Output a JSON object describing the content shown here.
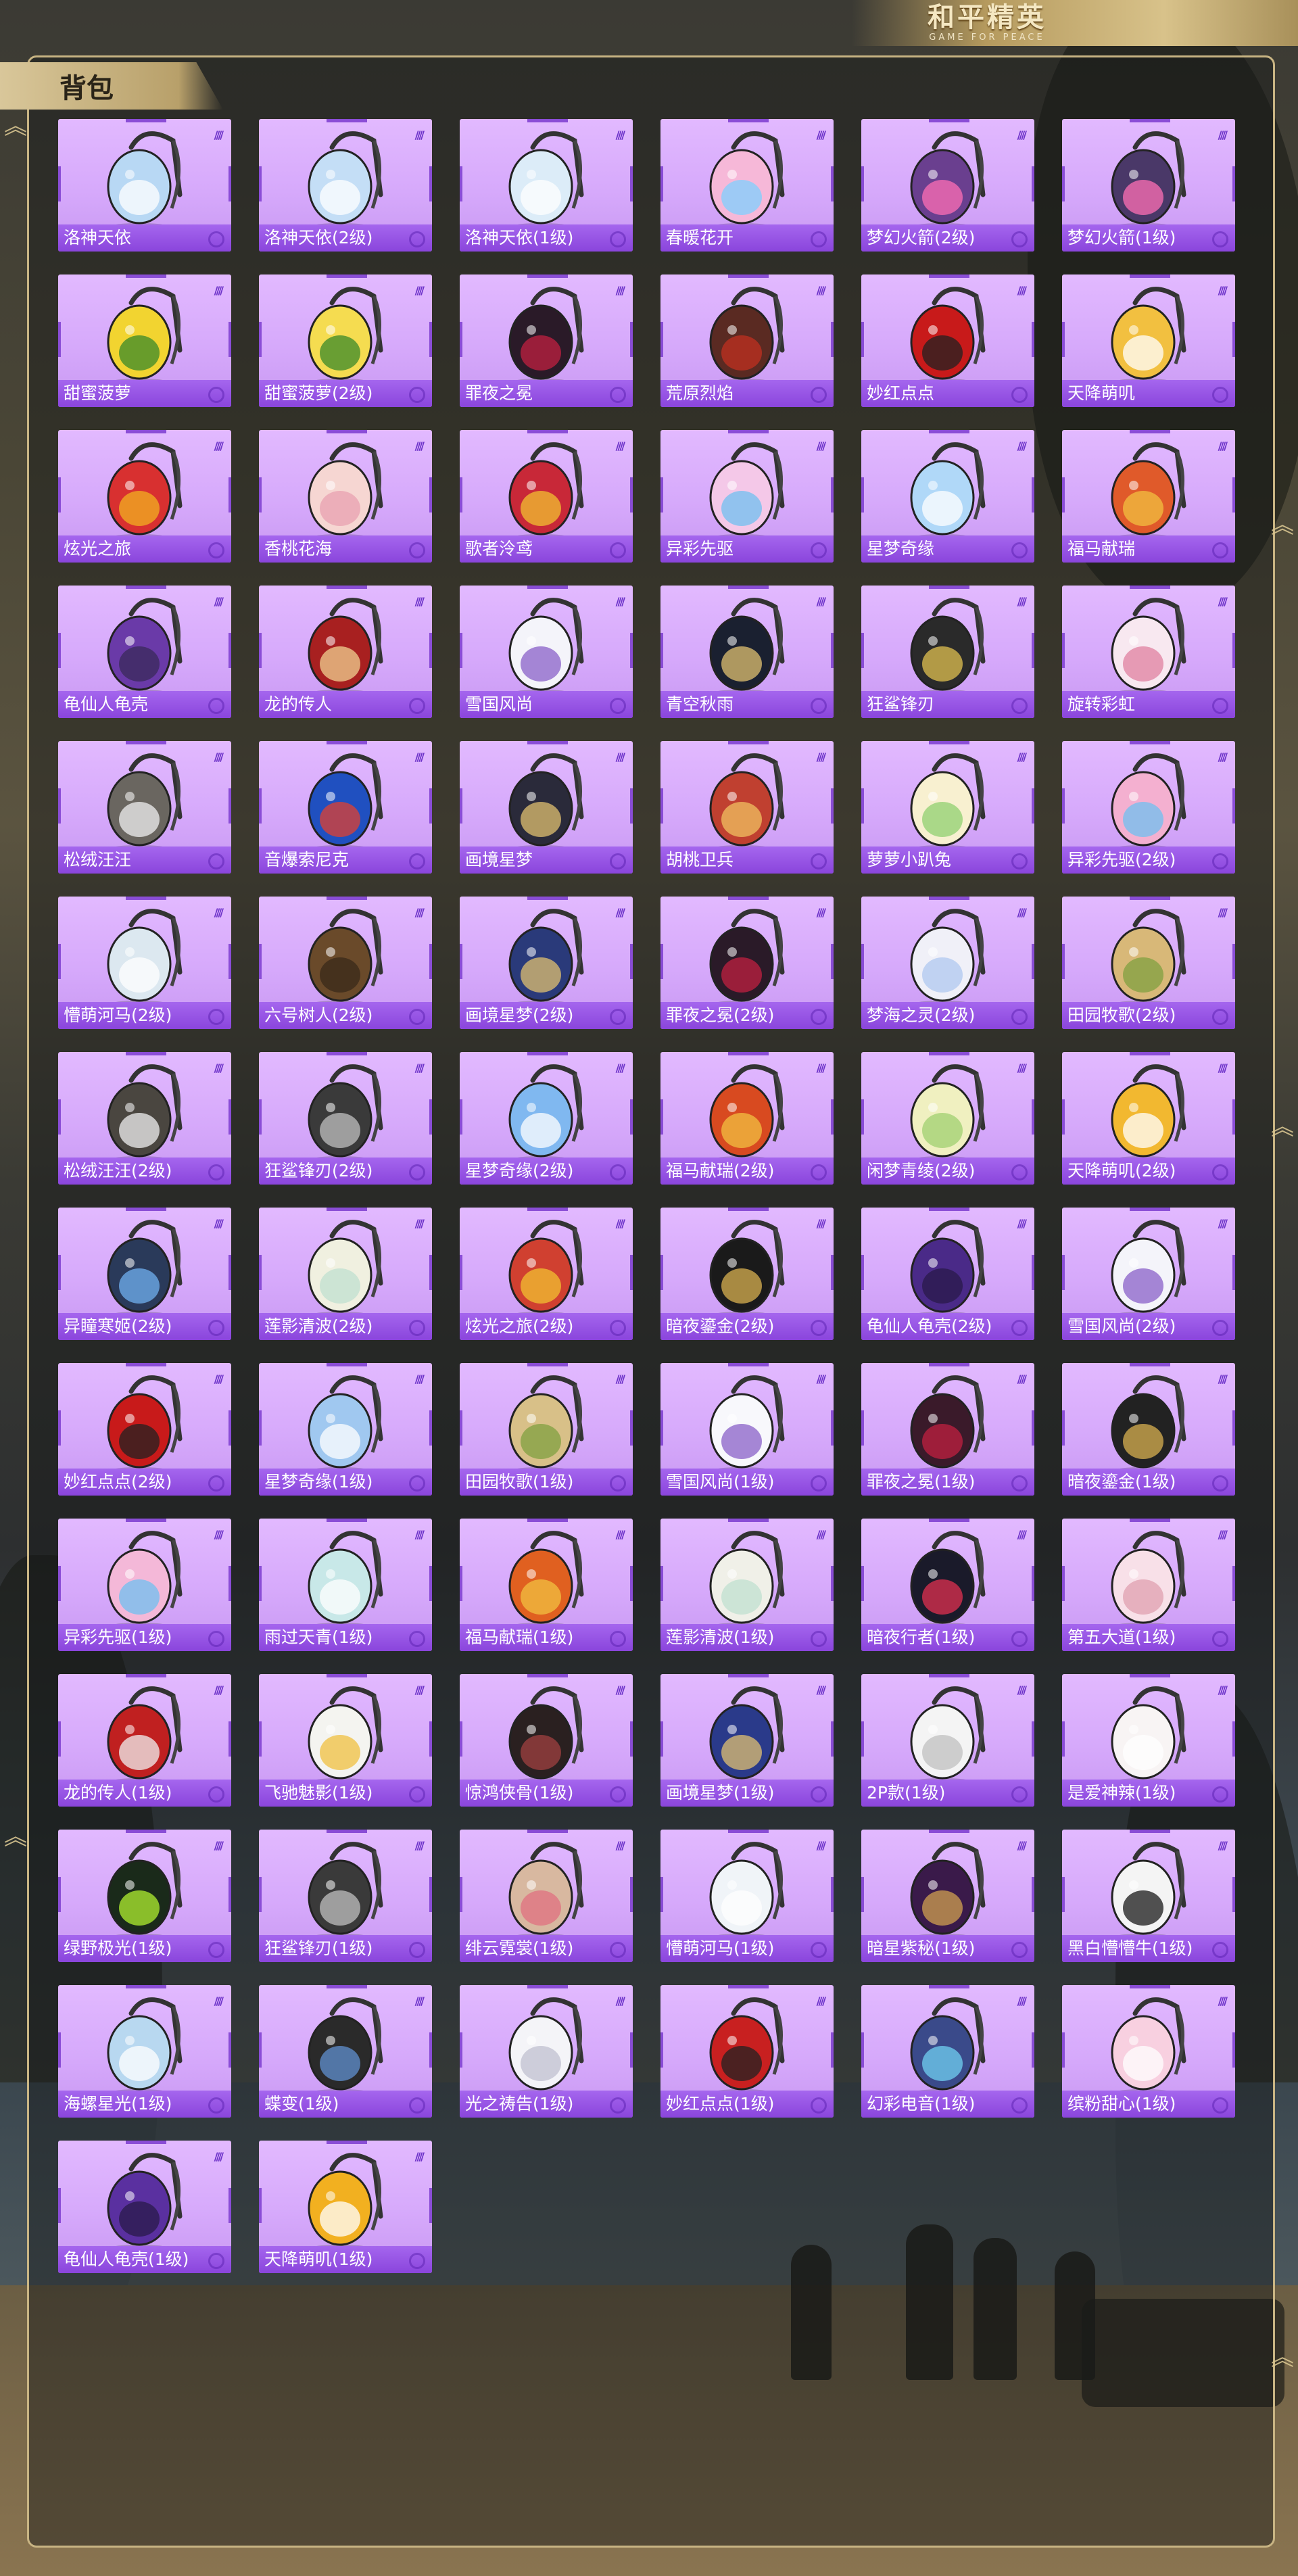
{
  "header": {
    "logo_title": "和平精英",
    "logo_subtitle": "GAME FOR PEACE",
    "tab_label": "背包"
  },
  "colors": {
    "card_bg": "#d6a9fb",
    "name_bar": "#8a45dc",
    "accent_gold": "#c8b483"
  },
  "rating_icon": "////",
  "items": [
    {
      "name": "洛神天依",
      "color": "#b8d8f4",
      "accent": "#ffffff"
    },
    {
      "name": "洛神天依(2级)",
      "color": "#c4def6",
      "accent": "#ffffff"
    },
    {
      "name": "洛神天依(1级)",
      "color": "#dcecf8",
      "accent": "#ffffff"
    },
    {
      "name": "春暖花开",
      "color": "#f6b8d8",
      "accent": "#7fd0ff"
    },
    {
      "name": "梦幻火箭(2级)",
      "color": "#6a3f8f",
      "accent": "#ff6fb4"
    },
    {
      "name": "梦幻火箭(1级)",
      "color": "#4a3868",
      "accent": "#ff6fb4"
    },
    {
      "name": "甜蜜菠萝",
      "color": "#f2d430",
      "accent": "#3a8a2a"
    },
    {
      "name": "甜蜜菠萝(2级)",
      "color": "#f5dc50",
      "accent": "#3a8a2a"
    },
    {
      "name": "罪夜之冕",
      "color": "#2a1a28",
      "accent": "#c02040"
    },
    {
      "name": "荒原烈焰",
      "color": "#5a2a22",
      "accent": "#c03020"
    },
    {
      "name": "妙红点点",
      "color": "#c81a1a",
      "accent": "#222222"
    },
    {
      "name": "天降萌叽",
      "color": "#f2c040",
      "accent": "#ffffff"
    },
    {
      "name": "炫光之旅",
      "color": "#d83030",
      "accent": "#f2b020"
    },
    {
      "name": "香桃花海",
      "color": "#f6d6d2",
      "accent": "#e8a0b0"
    },
    {
      "name": "歌者泠鸢",
      "color": "#c82838",
      "accent": "#f2c030"
    },
    {
      "name": "异彩先驱",
      "color": "#f4c8e8",
      "accent": "#70c0f0"
    },
    {
      "name": "星梦奇缘",
      "color": "#b0d8f8",
      "accent": "#ffffff"
    },
    {
      "name": "福马献瑞",
      "color": "#e05a2a",
      "accent": "#f2c040"
    },
    {
      "name": "龟仙人龟壳",
      "color": "#6a3aa8",
      "accent": "#3a2a5a"
    },
    {
      "name": "龙的传人",
      "color": "#a82020",
      "accent": "#f0d090"
    },
    {
      "name": "雪国风尚",
      "color": "#f4f4fa",
      "accent": "#8a60c8"
    },
    {
      "name": "青空秋雨",
      "color": "#1a2030",
      "accent": "#e0c070"
    },
    {
      "name": "狂鲨锋刃",
      "color": "#2a2a2a",
      "accent": "#e0c050"
    },
    {
      "name": "旋转彩虹",
      "color": "#f8e8f0",
      "accent": "#e080a0"
    },
    {
      "name": "松绒汪汪",
      "color": "#6a6660",
      "accent": "#f0f0f0"
    },
    {
      "name": "音爆索尼克",
      "color": "#2050c0",
      "accent": "#e04030"
    },
    {
      "name": "画境星梦",
      "color": "#2a2a3a",
      "accent": "#e0c070"
    },
    {
      "name": "胡桃卫兵",
      "color": "#c04030",
      "accent": "#f0c060"
    },
    {
      "name": "萝萝小趴兔",
      "color": "#f8f0d0",
      "accent": "#90d070"
    },
    {
      "name": "异彩先驱(2级)",
      "color": "#f4b0d0",
      "accent": "#70c0f0"
    },
    {
      "name": "懵萌河马(2级)",
      "color": "#dce8f0",
      "accent": "#ffffff"
    },
    {
      "name": "六号树人(2级)",
      "color": "#6a4a2a",
      "accent": "#3a2a1a"
    },
    {
      "name": "画境星梦(2级)",
      "color": "#2a3a7a",
      "accent": "#e0c070"
    },
    {
      "name": "罪夜之冕(2级)",
      "color": "#2a1a28",
      "accent": "#c02040"
    },
    {
      "name": "梦海之灵(2级)",
      "color": "#f0f0f8",
      "accent": "#b0c8f0"
    },
    {
      "name": "田园牧歌(2级)",
      "color": "#d8b878",
      "accent": "#80a040"
    },
    {
      "name": "松绒汪汪(2级)",
      "color": "#4a4640",
      "accent": "#f0f0f0"
    },
    {
      "name": "狂鲨锋刃(2级)",
      "color": "#3a3a3a",
      "accent": "#c0c0c0"
    },
    {
      "name": "星梦奇缘(2级)",
      "color": "#80b8f0",
      "accent": "#ffffff"
    },
    {
      "name": "福马献瑞(2级)",
      "color": "#d84a20",
      "accent": "#f2c040"
    },
    {
      "name": "闲梦青绫(2级)",
      "color": "#f0f0c0",
      "accent": "#a0d070"
    },
    {
      "name": "天降萌叽(2级)",
      "color": "#f2b830",
      "accent": "#ffffff"
    },
    {
      "name": "异瞳寒姬(2级)",
      "color": "#2a3a5a",
      "accent": "#70b0f0"
    },
    {
      "name": "莲影清波(2级)",
      "color": "#f0f0e0",
      "accent": "#c0e0d0"
    },
    {
      "name": "炫光之旅(2级)",
      "color": "#d04030",
      "accent": "#f2c030"
    },
    {
      "name": "暗夜鎏金(2级)",
      "color": "#1a1a1a",
      "accent": "#d8b050"
    },
    {
      "name": "龟仙人龟壳(2级)",
      "color": "#4a2a88",
      "accent": "#2a1a4a"
    },
    {
      "name": "雪国风尚(2级)",
      "color": "#f4f4fa",
      "accent": "#8a60c8"
    },
    {
      "name": "妙红点点(2级)",
      "color": "#c81a1a",
      "accent": "#222222"
    },
    {
      "name": "星梦奇缘(1级)",
      "color": "#a0c8f0",
      "accent": "#ffffff"
    },
    {
      "name": "田园牧歌(1级)",
      "color": "#d8c088",
      "accent": "#80a040"
    },
    {
      "name": "雪国风尚(1级)",
      "color": "#f8f8fc",
      "accent": "#8a60c8"
    },
    {
      "name": "罪夜之冕(1级)",
      "color": "#3a1a2a",
      "accent": "#c02040"
    },
    {
      "name": "暗夜鎏金(1级)",
      "color": "#222222",
      "accent": "#d8b050"
    },
    {
      "name": "异彩先驱(1级)",
      "color": "#f4b8d8",
      "accent": "#70c0f0"
    },
    {
      "name": "雨过天青(1级)",
      "color": "#c8e8e8",
      "accent": "#ffffff"
    },
    {
      "name": "福马献瑞(1级)",
      "color": "#e06020",
      "accent": "#f2c040"
    },
    {
      "name": "莲影清波(1级)",
      "color": "#f0f0e8",
      "accent": "#c0e0d0"
    },
    {
      "name": "暗夜行者(1级)",
      "color": "#1a1a2a",
      "accent": "#e03050"
    },
    {
      "name": "第五大道(1级)",
      "color": "#f8e0e8",
      "accent": "#e0a0b0"
    },
    {
      "name": "龙的传人(1级)",
      "color": "#c02020",
      "accent": "#f0f0f0"
    },
    {
      "name": "飞驰魅影(1级)",
      "color": "#f4f4f0",
      "accent": "#f0c040"
    },
    {
      "name": "惊鸿侠骨(1级)",
      "color": "#2a2020",
      "accent": "#a04040"
    },
    {
      "name": "画境星梦(1级)",
      "color": "#2a3a8a",
      "accent": "#e0c070"
    },
    {
      "name": "2P款(1级)",
      "color": "#f4f4f4",
      "accent": "#c0c0c0"
    },
    {
      "name": "是爱神辣(1级)",
      "color": "#f8f4f4",
      "accent": "#ffffff"
    },
    {
      "name": "绿野极光(1级)",
      "color": "#1a2a1a",
      "accent": "#b0f030"
    },
    {
      "name": "狂鲨锋刃(1级)",
      "color": "#3a3a3a",
      "accent": "#c0c0c0"
    },
    {
      "name": "绯云霓裳(1级)",
      "color": "#d8b8a0",
      "accent": "#e07080"
    },
    {
      "name": "懵萌河马(1级)",
      "color": "#f0f4f8",
      "accent": "#ffffff"
    },
    {
      "name": "暗星紫秘(1级)",
      "color": "#3a1a4a",
      "accent": "#d0a050"
    },
    {
      "name": "黑白懵懵牛(1级)",
      "color": "#f4f4f4",
      "accent": "#1a1a1a"
    },
    {
      "name": "海螺星光(1级)",
      "color": "#b8d8f0",
      "accent": "#ffffff"
    },
    {
      "name": "蝶变(1级)",
      "color": "#2a2a2a",
      "accent": "#6090d0"
    },
    {
      "name": "光之祷告(1级)",
      "color": "#f4f4f8",
      "accent": "#c0c0d0"
    },
    {
      "name": "妙红点点(1级)",
      "color": "#c82020",
      "accent": "#222222"
    },
    {
      "name": "幻彩电音(1级)",
      "color": "#3a4a8a",
      "accent": "#70d0f0"
    },
    {
      "name": "缤粉甜心(1级)",
      "color": "#f8d0e0",
      "accent": "#ffffff"
    },
    {
      "name": "龟仙人龟壳(1级)",
      "color": "#5a30a0",
      "accent": "#2a1a4a"
    },
    {
      "name": "天降萌叽(1级)",
      "color": "#f2b020",
      "accent": "#ffffff"
    }
  ]
}
